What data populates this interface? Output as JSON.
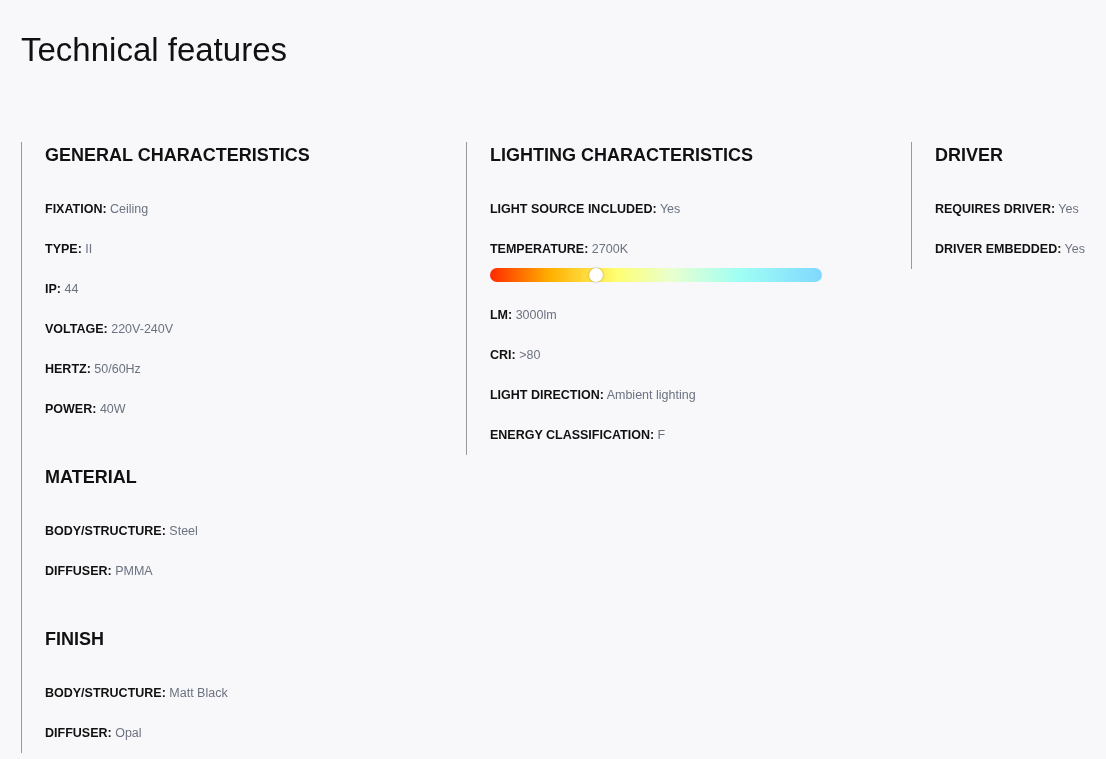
{
  "title": "Technical features",
  "columns": [
    {
      "sections": [
        {
          "heading": "GENERAL CHARACTERISTICS",
          "items": [
            {
              "kind": "text",
              "label": "FIXATION:",
              "value": "Ceiling"
            },
            {
              "kind": "text",
              "label": "TYPE:",
              "value": "II"
            },
            {
              "kind": "text",
              "label": "IP:",
              "value": "44"
            },
            {
              "kind": "text",
              "label": "VOLTAGE:",
              "value": "220V-240V"
            },
            {
              "kind": "text",
              "label": "HERTZ:",
              "value": "50/60Hz"
            },
            {
              "kind": "text",
              "label": "POWER:",
              "value": "40W"
            }
          ]
        },
        {
          "heading": "MATERIAL",
          "items": [
            {
              "kind": "text",
              "label": "BODY/STRUCTURE:",
              "value": "Steel"
            },
            {
              "kind": "text",
              "label": "DIFFUSER:",
              "value": "PMMA"
            }
          ]
        },
        {
          "heading": "FINISH",
          "items": [
            {
              "kind": "text",
              "label": "BODY/STRUCTURE:",
              "value": "Matt Black"
            },
            {
              "kind": "text",
              "label": "DIFFUSER:",
              "value": "Opal"
            }
          ]
        }
      ]
    },
    {
      "sections": [
        {
          "heading": "LIGHTING CHARACTERISTICS",
          "items": [
            {
              "kind": "text",
              "label": "LIGHT SOURCE INCLUDED:",
              "value": "Yes"
            },
            {
              "kind": "temperature",
              "label": "TEMPERATURE:",
              "value": "2700K",
              "level": 0.32
            },
            {
              "kind": "text",
              "label": "LM:",
              "value": "3000lm"
            },
            {
              "kind": "text",
              "label": "CRI:",
              "value": ">80"
            },
            {
              "kind": "text",
              "label": "LIGHT DIRECTION:",
              "value": "Ambient lighting"
            },
            {
              "kind": "text",
              "label": "ENERGY CLASSIFICATION:",
              "value": "F"
            }
          ]
        }
      ]
    },
    {
      "sections": [
        {
          "heading": "DRIVER",
          "items": [
            {
              "kind": "text",
              "label": "REQUIRES DRIVER:",
              "value": "Yes"
            },
            {
              "kind": "text",
              "label": "DRIVER EMBEDDED:",
              "value": "Yes"
            }
          ]
        }
      ]
    }
  ]
}
